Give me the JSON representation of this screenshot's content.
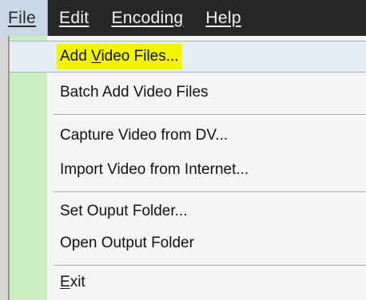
{
  "menubar": {
    "items": [
      {
        "label": "File"
      },
      {
        "label": "Edit"
      },
      {
        "label": "Encoding"
      },
      {
        "label": "Help"
      }
    ]
  },
  "file_menu": {
    "items": [
      {
        "pre": "Add ",
        "key": "V",
        "post": "ideo Files..."
      },
      {
        "label": "Batch Add Video Files"
      },
      {
        "label": "Capture Video from DV..."
      },
      {
        "label": "Import Video from Internet..."
      },
      {
        "label": "Set Ouput Folder..."
      },
      {
        "label": "Open Output Folder"
      },
      {
        "key": "E",
        "post": "xit"
      }
    ]
  },
  "colors": {
    "menubar_bg": "#262626",
    "gutter": "#c9efc0",
    "highlight": "#f3f200"
  }
}
